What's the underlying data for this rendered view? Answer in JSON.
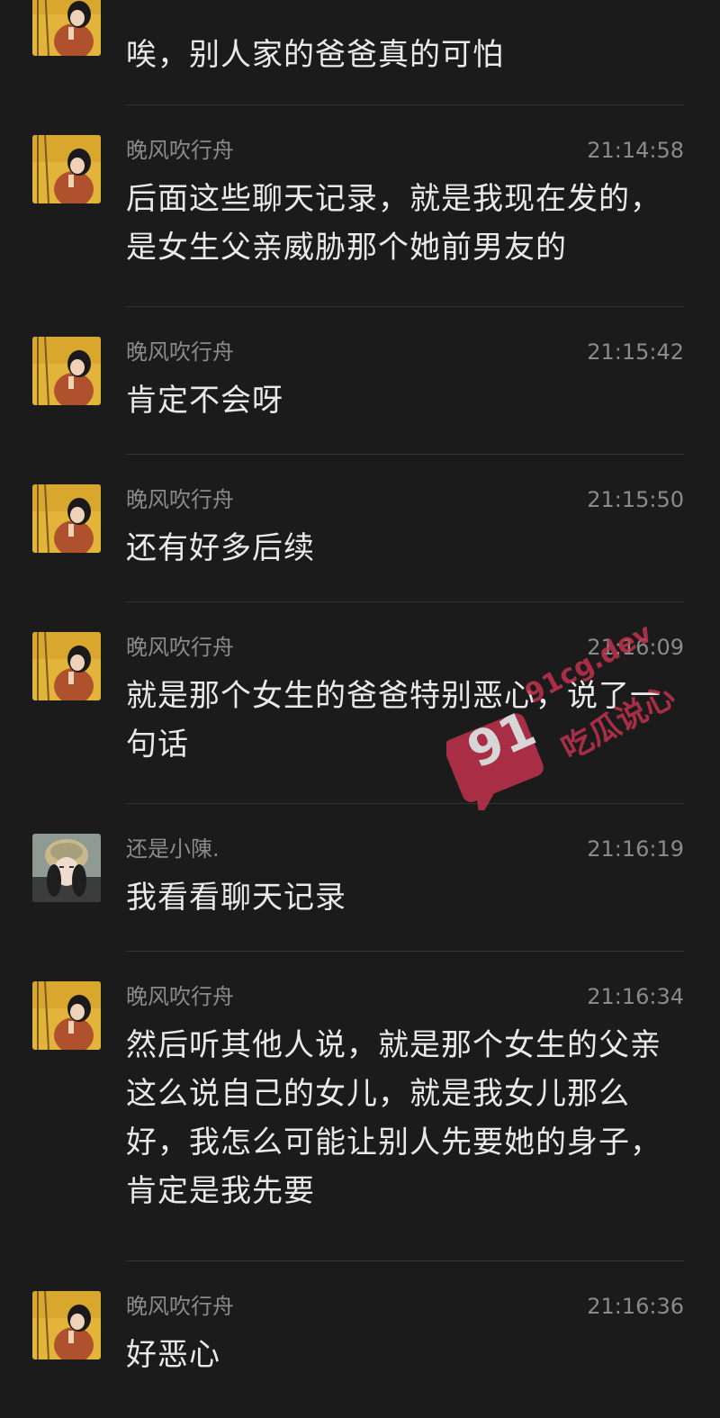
{
  "messages": [
    {
      "sender": "",
      "time": "",
      "text": "唉，别人家的爸爸真的可怕",
      "avatar": "illustrated-girl-avatar"
    },
    {
      "sender": "晚风吹行舟",
      "time": "21:14:58",
      "text": "后面这些聊天记录，就是我现在发的，是女生父亲威胁那个她前男友的",
      "avatar": "illustrated-girl-avatar"
    },
    {
      "sender": "晚风吹行舟",
      "time": "21:15:42",
      "text": "肯定不会呀",
      "avatar": "illustrated-girl-avatar"
    },
    {
      "sender": "晚风吹行舟",
      "time": "21:15:50",
      "text": "还有好多后续",
      "avatar": "illustrated-girl-avatar"
    },
    {
      "sender": "晚风吹行舟",
      "time": "21:16:09",
      "text": "就是那个女生的爸爸特别恶心，说了一句话",
      "avatar": "illustrated-girl-avatar"
    },
    {
      "sender": "还是小陳.",
      "time": "21:16:19",
      "text": "我看看聊天记录",
      "avatar": "photo-girl-helmet-avatar"
    },
    {
      "sender": "晚风吹行舟",
      "time": "21:16:34",
      "text": "然后听其他人说，就是那个女生的父亲这么说自己的女儿，就是我女儿那么好，我怎么可能让别人先要她的身子，肯定是我先要",
      "avatar": "illustrated-girl-avatar"
    },
    {
      "sender": "晚风吹行舟",
      "time": "21:16:36",
      "text": "好恶心",
      "avatar": "illustrated-girl-avatar"
    }
  ],
  "watermark": {
    "number": "91",
    "domain": "91cg.dev",
    "brand": "吃瓜说心"
  },
  "colors": {
    "background": "#1b1b1c",
    "text": "#e9e9e9",
    "meta": "#8a8a8a",
    "divider": "#333335",
    "watermark": "#c8334e"
  }
}
